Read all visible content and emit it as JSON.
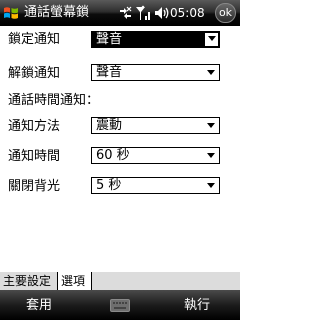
{
  "title_bar": {
    "app_title": "通話螢幕鎖",
    "clock": "05:08",
    "ok_label": "ok"
  },
  "form": {
    "lock_notify": {
      "label": "鎖定通知",
      "value": "聲音"
    },
    "unlock_notify": {
      "label": "解鎖通知",
      "value": "聲音"
    },
    "section_heading": "通話時間通知：",
    "notify_method": {
      "label": "通知方法",
      "value": "震動"
    },
    "notify_time": {
      "label": "通知時間",
      "value": "60 秒"
    },
    "backlight_off": {
      "label": "關閉背光",
      "value": "5 秒"
    }
  },
  "tabs": [
    {
      "label": "主要設定"
    },
    {
      "label": "選項"
    }
  ],
  "softkeys": {
    "left": "套用",
    "right": "執行"
  }
}
